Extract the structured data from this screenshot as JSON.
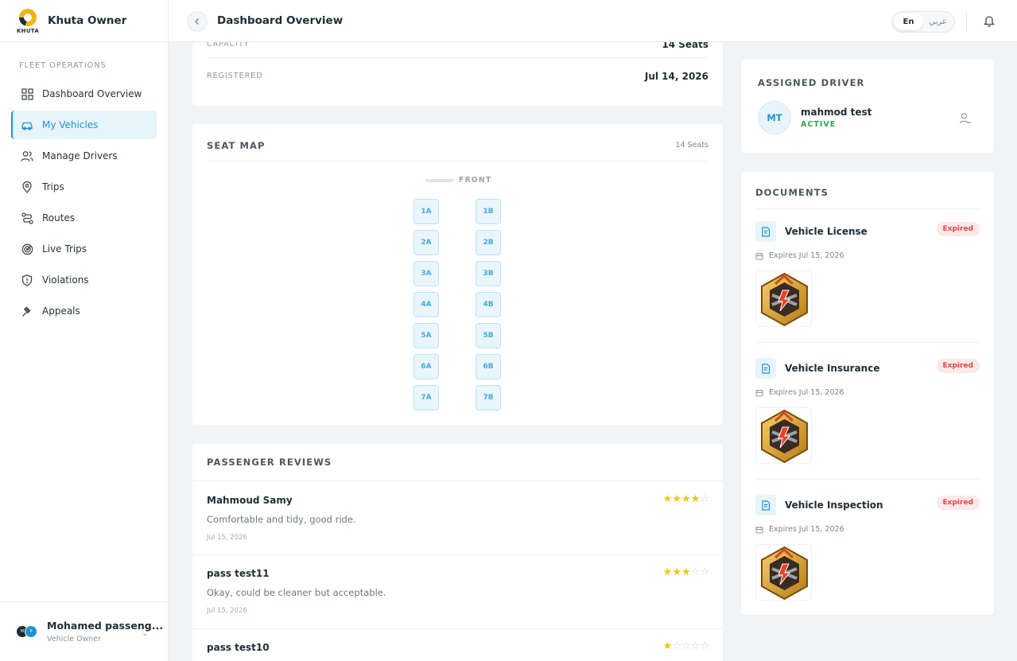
{
  "app": {
    "brand_title": "Khuta Owner",
    "brand_word": "KHUTA"
  },
  "sidebar": {
    "section": "FLEET OPERATIONS",
    "items": [
      {
        "label": "Dashboard Overview",
        "icon": "grid-icon"
      },
      {
        "label": "My Vehicles",
        "icon": "car-icon",
        "active": true
      },
      {
        "label": "Manage Drivers",
        "icon": "users-icon"
      },
      {
        "label": "Trips",
        "icon": "map-pin-icon"
      },
      {
        "label": "Routes",
        "icon": "route-icon"
      },
      {
        "label": "Live Trips",
        "icon": "radar-icon"
      },
      {
        "label": "Violations",
        "icon": "shield-alert-icon"
      },
      {
        "label": "Appeals",
        "icon": "gavel-icon"
      }
    ],
    "user": {
      "name": "Mohamed passeng...",
      "role": "Vehicle Owner",
      "avatar_initials": "MP"
    }
  },
  "header": {
    "title": "Dashboard Overview",
    "lang_en": "En",
    "lang_ar": "عربي"
  },
  "vehicle_info": {
    "capacity_label": "CAPACITY",
    "capacity_value": "14 Seats",
    "registered_label": "REGISTERED",
    "registered_value": "Jul 14, 2026"
  },
  "seat_map": {
    "title": "SEAT MAP",
    "count": "14 Seats",
    "front": "FRONT",
    "seats": [
      "1A",
      "1B",
      "2A",
      "2B",
      "3A",
      "3B",
      "4A",
      "4B",
      "5A",
      "5B",
      "6A",
      "6B",
      "7A",
      "7B"
    ]
  },
  "reviews": {
    "title": "PASSENGER REVIEWS",
    "items": [
      {
        "name": "Mahmoud Samy",
        "text": "Comfortable and tidy, good ride.",
        "date": "Jul 15, 2026",
        "rating": 4
      },
      {
        "name": "pass test11",
        "text": "Okay, could be cleaner but acceptable.",
        "date": "Jul 15, 2026",
        "rating": 3
      },
      {
        "name": "pass test10",
        "text": "",
        "date": "",
        "rating": 1
      }
    ]
  },
  "driver": {
    "title": "ASSIGNED DRIVER",
    "initials": "MT",
    "name": "mahmod test",
    "status": "ACTIVE"
  },
  "documents": {
    "title": "DOCUMENTS",
    "items": [
      {
        "name": "Vehicle License",
        "status": "Expired",
        "expires": "Expires Jul 15, 2026"
      },
      {
        "name": "Vehicle Insurance",
        "status": "Expired",
        "expires": "Expires Jul 15, 2026"
      },
      {
        "name": "Vehicle Inspection",
        "status": "Expired",
        "expires": "Expires Jul 15, 2026"
      }
    ]
  },
  "colors": {
    "accent": "#1f93cf",
    "active_green": "#2ea44f",
    "expired_red": "#e04646",
    "star": "#f1c40f"
  }
}
